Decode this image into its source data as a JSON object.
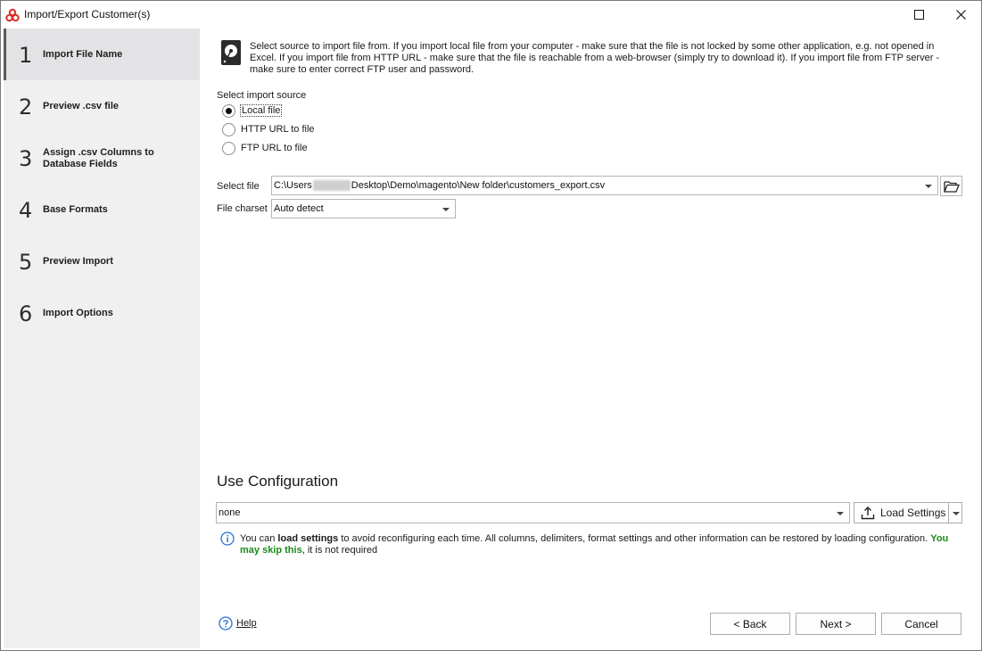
{
  "window": {
    "title": "Import/Export Customer(s)"
  },
  "sidebar": {
    "steps": [
      {
        "num": "1",
        "label": "Import File Name",
        "active": true
      },
      {
        "num": "2",
        "label": "Preview .csv file"
      },
      {
        "num": "3",
        "label": "Assign .csv Columns to Database Fields"
      },
      {
        "num": "4",
        "label": "Base Formats"
      },
      {
        "num": "5",
        "label": "Preview Import"
      },
      {
        "num": "6",
        "label": "Import Options"
      }
    ]
  },
  "main": {
    "info_text": "Select source to import file from. If you import local file from your computer - make sure that the file is not locked by some other application, e.g. not opened in Excel. If you import file from HTTP URL - make sure that the file is reachable from a web-browser (simply try to download it). If you import file from FTP server - make sure to enter correct FTP user and password.",
    "source_label": "Select import source",
    "sources": [
      {
        "label": "Local file",
        "checked": true
      },
      {
        "label": "HTTP URL to file",
        "checked": false
      },
      {
        "label": "FTP URL to file",
        "checked": false
      }
    ],
    "select_file_label": "Select file",
    "select_file_prefix": "C:\\Users",
    "select_file_suffix": "Desktop\\Demo\\magento\\New folder\\customers_export.csv",
    "charset_label": "File charset",
    "charset_value": "Auto detect",
    "use_config_title": "Use Configuration",
    "config_value": "none",
    "load_settings_label": "Load Settings",
    "hint": {
      "part1": "You can ",
      "bold": "load settings",
      "part2": " to avoid reconfiguring each time. All columns, delimiters, format settings and other information can be restored by loading configuration. ",
      "green": "You may skip this",
      "part3": ", it is not required"
    }
  },
  "footer": {
    "help_label": "Help",
    "back_label": "< Back",
    "next_label": "Next >",
    "cancel_label": "Cancel"
  },
  "icons": {
    "app": "app-logo-icon",
    "maximize": "maximize-icon",
    "close": "close-icon",
    "disk": "hard-disk-icon",
    "folder": "open-folder-icon",
    "upload": "upload-icon",
    "info": "info-icon",
    "help": "help-icon"
  }
}
